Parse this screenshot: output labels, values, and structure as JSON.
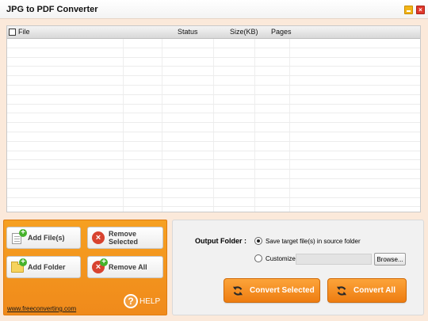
{
  "window": {
    "title": "JPG to PDF Converter"
  },
  "table": {
    "columns": [
      "File",
      "Status",
      "Size(KB)",
      "Pages"
    ],
    "row_count": 21
  },
  "actions": {
    "add_files": "Add File(s)",
    "remove_selected": "Remove Selected",
    "add_folder": "Add Folder",
    "remove_all": "Remove All",
    "help": "HELP",
    "site_link": "www.freeconverting.com"
  },
  "output": {
    "label": "Output Folder :",
    "option_source": "Save target file(s) in source folder",
    "option_customize": "Customize :",
    "selected_option": "source",
    "path_value": "",
    "browse": "Browse..."
  },
  "convert": {
    "selected": "Convert Selected",
    "all": "Convert All"
  },
  "colors": {
    "accent_orange": "#f08a1b",
    "window_bg": "#fbe9da"
  }
}
